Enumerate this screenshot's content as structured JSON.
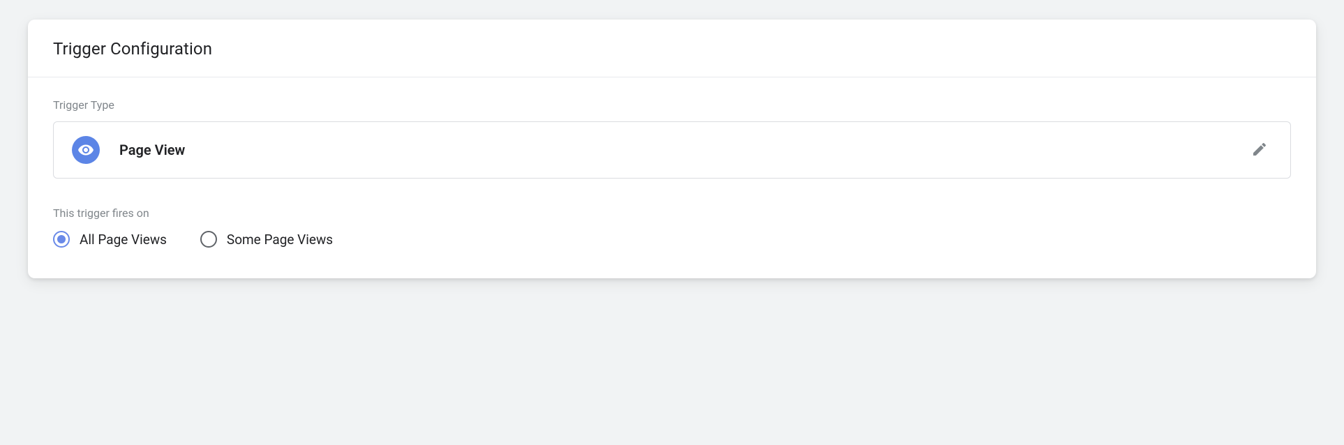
{
  "card": {
    "title": "Trigger Configuration"
  },
  "triggerType": {
    "label": "Trigger Type",
    "selected": "Page View",
    "icon": "eye-icon"
  },
  "firesOn": {
    "label": "This trigger fires on",
    "options": [
      {
        "label": "All Page Views",
        "selected": true
      },
      {
        "label": "Some Page Views",
        "selected": false
      }
    ]
  }
}
